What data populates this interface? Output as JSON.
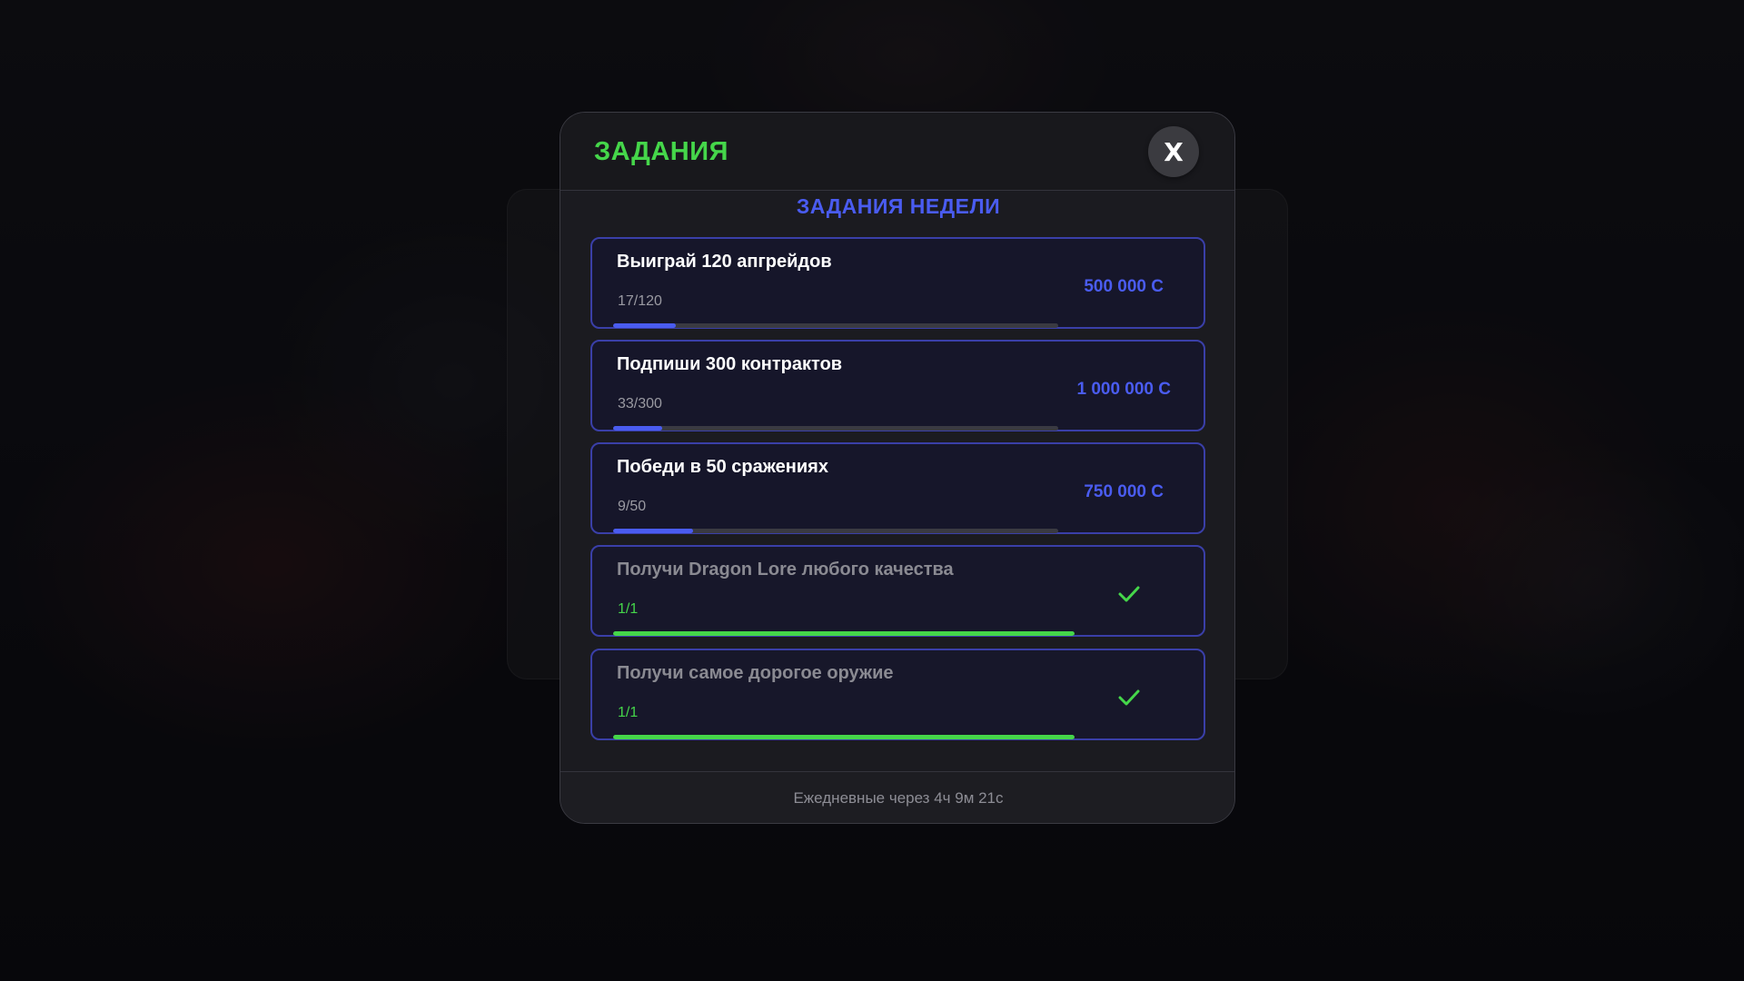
{
  "modal": {
    "title": "ЗАДАНИЯ",
    "close_label": "X",
    "section_title": "ЗАДАНИЯ НЕДЕЛИ",
    "footer_text": "Ежедневные через 4ч 9м 21с"
  },
  "tasks": [
    {
      "name": "Выиграй 120 апгрейдов",
      "progress": "17/120",
      "reward": "500 000 C",
      "completed": false,
      "fraction": 0.14
    },
    {
      "name": "Подпиши 300 контрактов",
      "progress": "33/300",
      "reward": "1 000 000 C",
      "completed": false,
      "fraction": 0.11
    },
    {
      "name": "Победи в 50 сражениях",
      "progress": "9/50",
      "reward": "750 000 C",
      "completed": false,
      "fraction": 0.18
    },
    {
      "name": "Получи Dragon Lore любого качества",
      "progress": "1/1",
      "reward": "",
      "completed": true,
      "icon": "check-icon",
      "fraction": 1.0
    },
    {
      "name": "Получи самое дорогое оружие",
      "progress": "1/1",
      "reward": "",
      "completed": true,
      "icon": "check-icon",
      "fraction": 1.0
    }
  ],
  "colors": {
    "title_green": "#45d64a",
    "accent_blue": "#4a5cf0",
    "panel_bg": "#1b1b20",
    "task_border": "#3a3fa8"
  }
}
